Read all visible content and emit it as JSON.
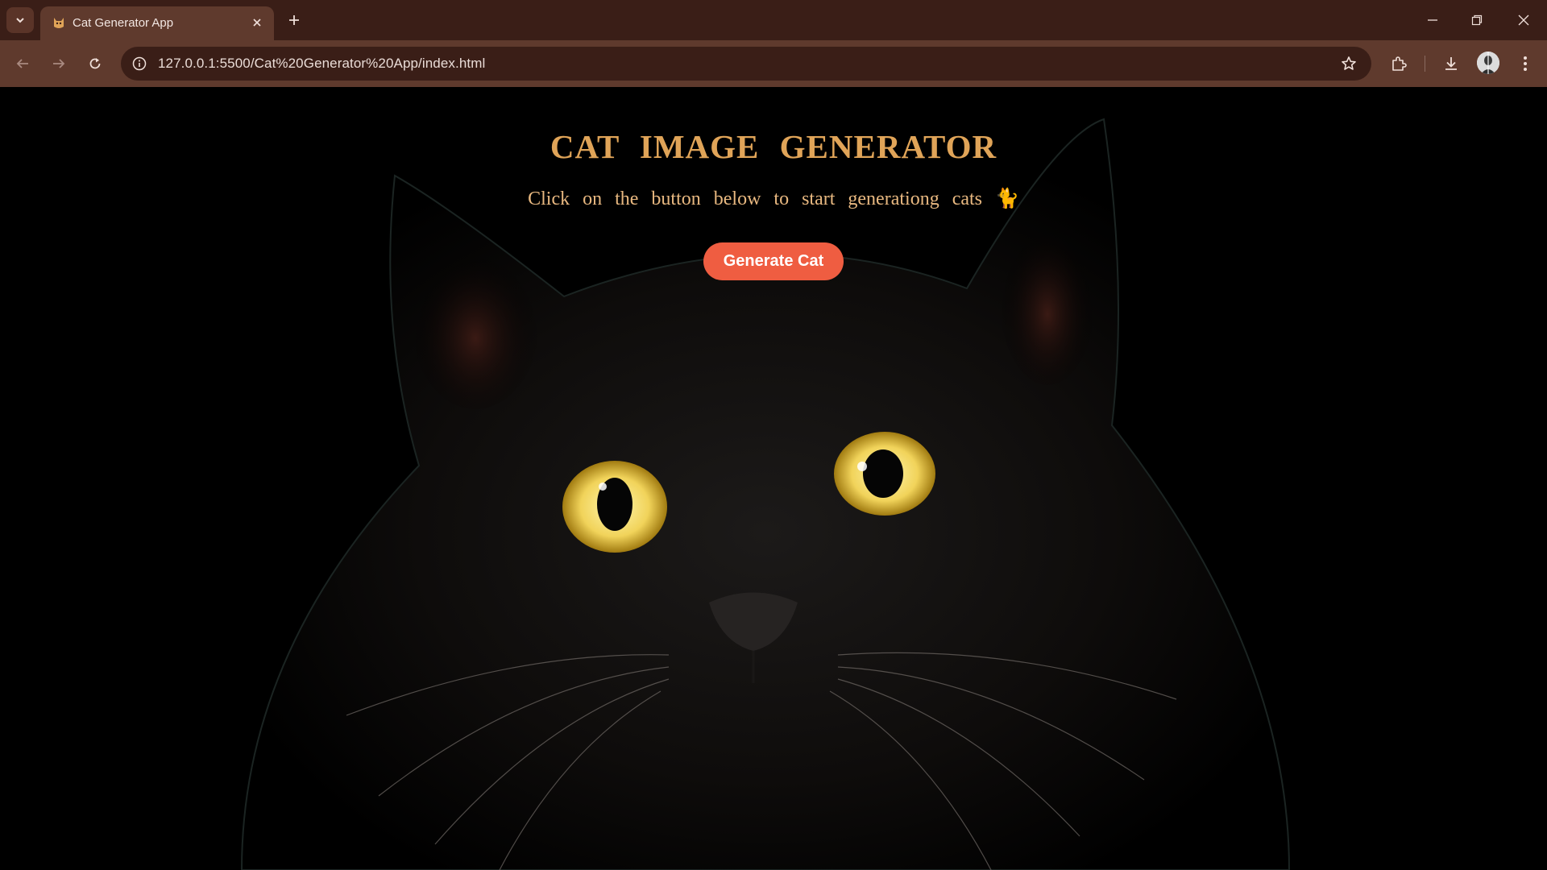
{
  "browser": {
    "tab": {
      "title": "Cat Generator App",
      "favicon": "cat-favicon-icon"
    },
    "address_bar": {
      "url": "127.0.0.1:5500/Cat%20Generator%20App/index.html"
    },
    "icons": [
      "tab-search-icon",
      "close-icon",
      "plus-icon",
      "minimize-icon",
      "restore-icon",
      "window-close-icon",
      "back-arrow-icon",
      "forward-arrow-icon",
      "reload-icon",
      "site-info-icon",
      "bookmark-star-icon",
      "extensions-icon",
      "download-icon",
      "profile-avatar",
      "more-menu-icon"
    ]
  },
  "page": {
    "heading": "CAT IMAGE GENERATOR",
    "subtext": "Click on the button below to start generationg cats",
    "subtext_emoji": "🐈",
    "button_label": "Generate Cat",
    "background": "black cat with yellow eyes",
    "colors": {
      "heading": "#e0a458",
      "subtext": "#e8b880",
      "button": "#ef5d41",
      "button_text": "#ffffff"
    }
  }
}
